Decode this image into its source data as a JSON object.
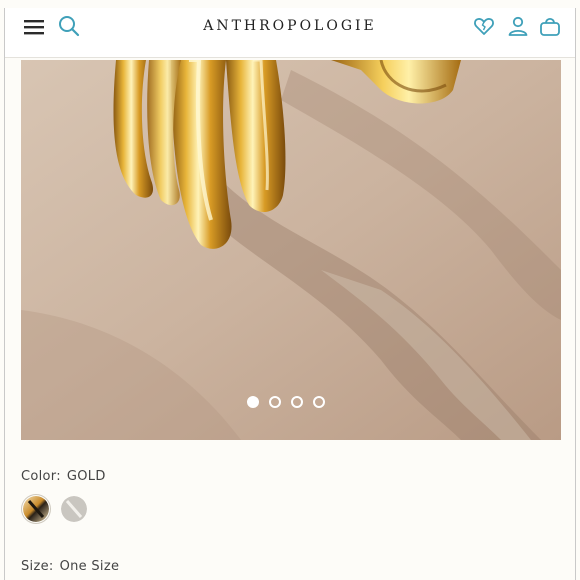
{
  "header": {
    "brand": "ANTHROPOLOGIE",
    "icons": [
      "menu-icon",
      "search-icon",
      "heart-icon",
      "account-icon",
      "shopping-bag-icon"
    ],
    "accent_color": "#3fa0b9"
  },
  "gallery": {
    "image_count": 4,
    "active_index": 0
  },
  "color": {
    "label": "Color:",
    "value": "GOLD",
    "options": [
      {
        "name": "gold-swatch",
        "selected": true
      },
      {
        "name": "silver-swatch",
        "selected": false
      }
    ]
  },
  "size": {
    "label": "Size:",
    "value": "One Size"
  }
}
